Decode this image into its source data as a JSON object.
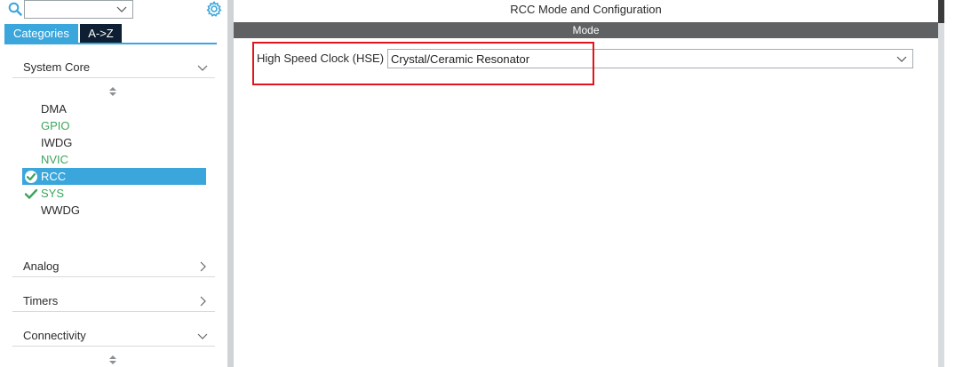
{
  "sidebar": {
    "search": {
      "value": ""
    },
    "tabs": [
      {
        "label": "Categories"
      },
      {
        "label": "A->Z"
      }
    ],
    "categories": [
      {
        "label": "System Core",
        "expanded": true
      },
      {
        "label": "Analog",
        "expanded": false
      },
      {
        "label": "Timers",
        "expanded": false
      },
      {
        "label": "Connectivity",
        "expanded": true
      }
    ],
    "system_core_items": [
      {
        "label": "DMA",
        "state": "normal"
      },
      {
        "label": "GPIO",
        "state": "configured"
      },
      {
        "label": "IWDG",
        "state": "normal"
      },
      {
        "label": "NVIC",
        "state": "configured"
      },
      {
        "label": "RCC",
        "state": "selected"
      },
      {
        "label": "SYS",
        "state": "checked"
      },
      {
        "label": "WWDG",
        "state": "normal"
      }
    ]
  },
  "main": {
    "title": "RCC Mode and Configuration",
    "mode_header": "Mode",
    "hse": {
      "label": "High Speed Clock (HSE)",
      "value": "Crystal/Ceramic Resonator"
    }
  },
  "colors": {
    "accent_blue": "#3aa6dc",
    "dark_tab": "#0f1f33",
    "configured_green": "#3ca55c",
    "mode_bar": "#5f6163",
    "highlight_red": "#e0141b"
  },
  "icons": [
    "search-icon",
    "gear-icon",
    "chevron-down-icon",
    "chevron-right-icon",
    "check-circle-icon",
    "check-icon",
    "scroll-arrows-icon"
  ]
}
